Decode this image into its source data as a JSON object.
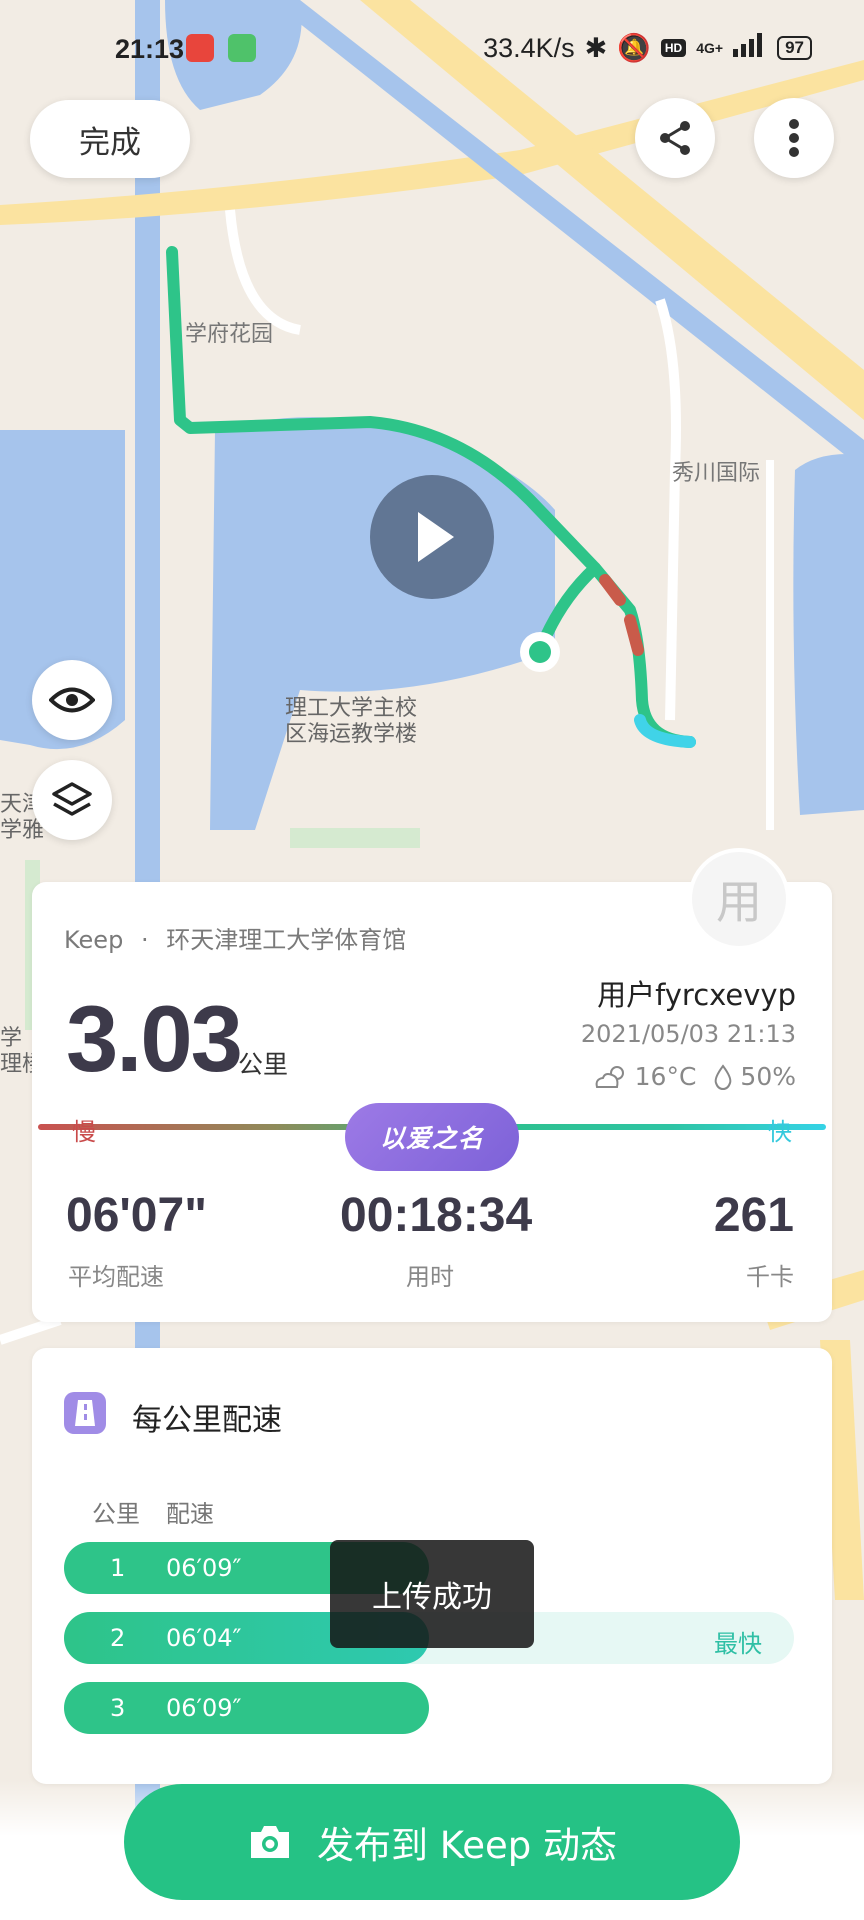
{
  "status_bar": {
    "time": "21:13",
    "network_speed": "33.4K/s",
    "network_type": "4G+",
    "hd_label": "HD",
    "battery": "97"
  },
  "top_bar": {
    "done_label": "完成"
  },
  "map": {
    "labels": [
      "学府花园",
      "秀川国际",
      "理工大学主校",
      "区海运教学楼",
      "天津",
      "学雅",
      "学",
      "理楼"
    ]
  },
  "summary": {
    "source": "Keep",
    "separator": "·",
    "location": "环天津理工大学体育馆",
    "distance": "3.03",
    "distance_unit": "公里",
    "avatar_char": "用",
    "username": "用户fyrcxevyp",
    "datetime": "2021/05/03 21:13",
    "temperature": "16°C",
    "humidity": "50%",
    "pace_slow_label": "慢",
    "pace_fast_label": "快",
    "badge": "以爱之名",
    "stats": [
      {
        "value": "06'07\"",
        "label": "平均配速"
      },
      {
        "value": "00:18:34",
        "label": "用时"
      },
      {
        "value": "261",
        "label": "千卡"
      }
    ]
  },
  "splits": {
    "title": "每公里配速",
    "col_km": "公里",
    "col_pace": "配速",
    "rows": [
      {
        "km": "1",
        "pace": "06′09″",
        "fraction": 0.5,
        "color": "#2ec489",
        "tag": ""
      },
      {
        "km": "2",
        "pace": "06′04″",
        "fraction": 0.5,
        "color": "#2ec9b0",
        "tag": "最快"
      },
      {
        "km": "3",
        "pace": "06′09″",
        "fraction": 0.5,
        "color": "#2ec489",
        "tag": ""
      }
    ]
  },
  "toast": "上传成功",
  "publish_label": "发布到 Keep 动态",
  "colors": {
    "accent_green": "#25c285",
    "water": "#a6c4ec",
    "land": "#f2ece4"
  }
}
